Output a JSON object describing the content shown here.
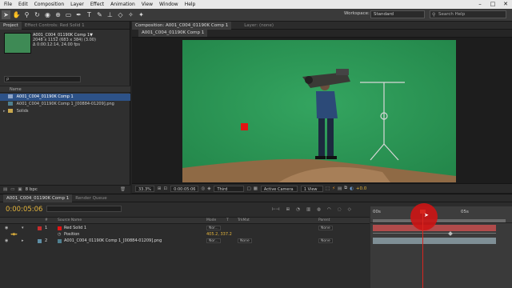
{
  "menubar": {
    "items": [
      "File",
      "Edit",
      "Composition",
      "Layer",
      "Effect",
      "Animation",
      "View",
      "Window",
      "Help"
    ],
    "window_buttons": [
      "–",
      "□",
      "✕"
    ]
  },
  "toolbar": {
    "tools": [
      "selection-tool",
      "hand-tool",
      "zoom-tool",
      "rotate-tool",
      "camera-tool",
      "pan-behind-tool",
      "mask-tool",
      "pen-tool",
      "type-tool",
      "brush-tool",
      "clone-tool",
      "eraser-tool",
      "roto-tool",
      "puppet-tool"
    ],
    "workspace_label": "Workspace:",
    "workspace_value": "Standard",
    "search_placeholder": "Search Help"
  },
  "project": {
    "tabs": [
      "Project",
      "Effect Controls: Red Solid 1"
    ],
    "item_name": "A001_C004_01190K Comp 1▼",
    "item_size": "2048 x 1152  (683 x 384) (3.00)",
    "item_duration": "Δ 0:00:12:14, 24.00 fps",
    "search_placeholder": "ρ",
    "column_name": "Name",
    "rows": [
      {
        "label": "A001_C004_01190K Comp 1",
        "type": "comp"
      },
      {
        "label": "A001_C004_01190K Comp 1_[00884-01209].png",
        "type": "footage"
      },
      {
        "label": "Solids",
        "type": "folder"
      }
    ],
    "footer_bpc": "8 bpc"
  },
  "composition": {
    "tabs": [
      "Composition: A001_C004_01190K Comp 1",
      "Layer: (none)"
    ],
    "subtab": "A001_C004_01190K Comp 1",
    "zoom": "33.3%",
    "timecode": "0:00:05:06",
    "resolution": "Third",
    "camera": "Active Camera",
    "view": "1 View",
    "exposure": "+0.0"
  },
  "timeline": {
    "tabs": [
      "A001_C004_01190K Comp 1",
      "Render Queue"
    ],
    "timecode": "0:00:05:06",
    "columns": [
      "#",
      "Source Name",
      "Mode",
      "T",
      "TrkMat",
      "Parent"
    ],
    "ruler_labels": [
      "00s",
      "05s"
    ],
    "layers": [
      {
        "num": "1",
        "name": "Red Solid 1",
        "color": "#c42d2d",
        "mode": "Nor...",
        "parent": "None"
      },
      {
        "num": "",
        "name": "Position",
        "value": "405.2, 337.2",
        "is_property": true
      },
      {
        "num": "2",
        "name": "A001_C004_01190K Comp 1_[00884-01209].png",
        "color": "#5e8ea6",
        "mode": "Nor...",
        "trkmat": "None",
        "parent": "None"
      }
    ]
  },
  "colors": {
    "greenscreen": "#2e9657",
    "red_solid": "#e21313",
    "timecode": "#e3b43c",
    "playhead": "#d8261f"
  }
}
